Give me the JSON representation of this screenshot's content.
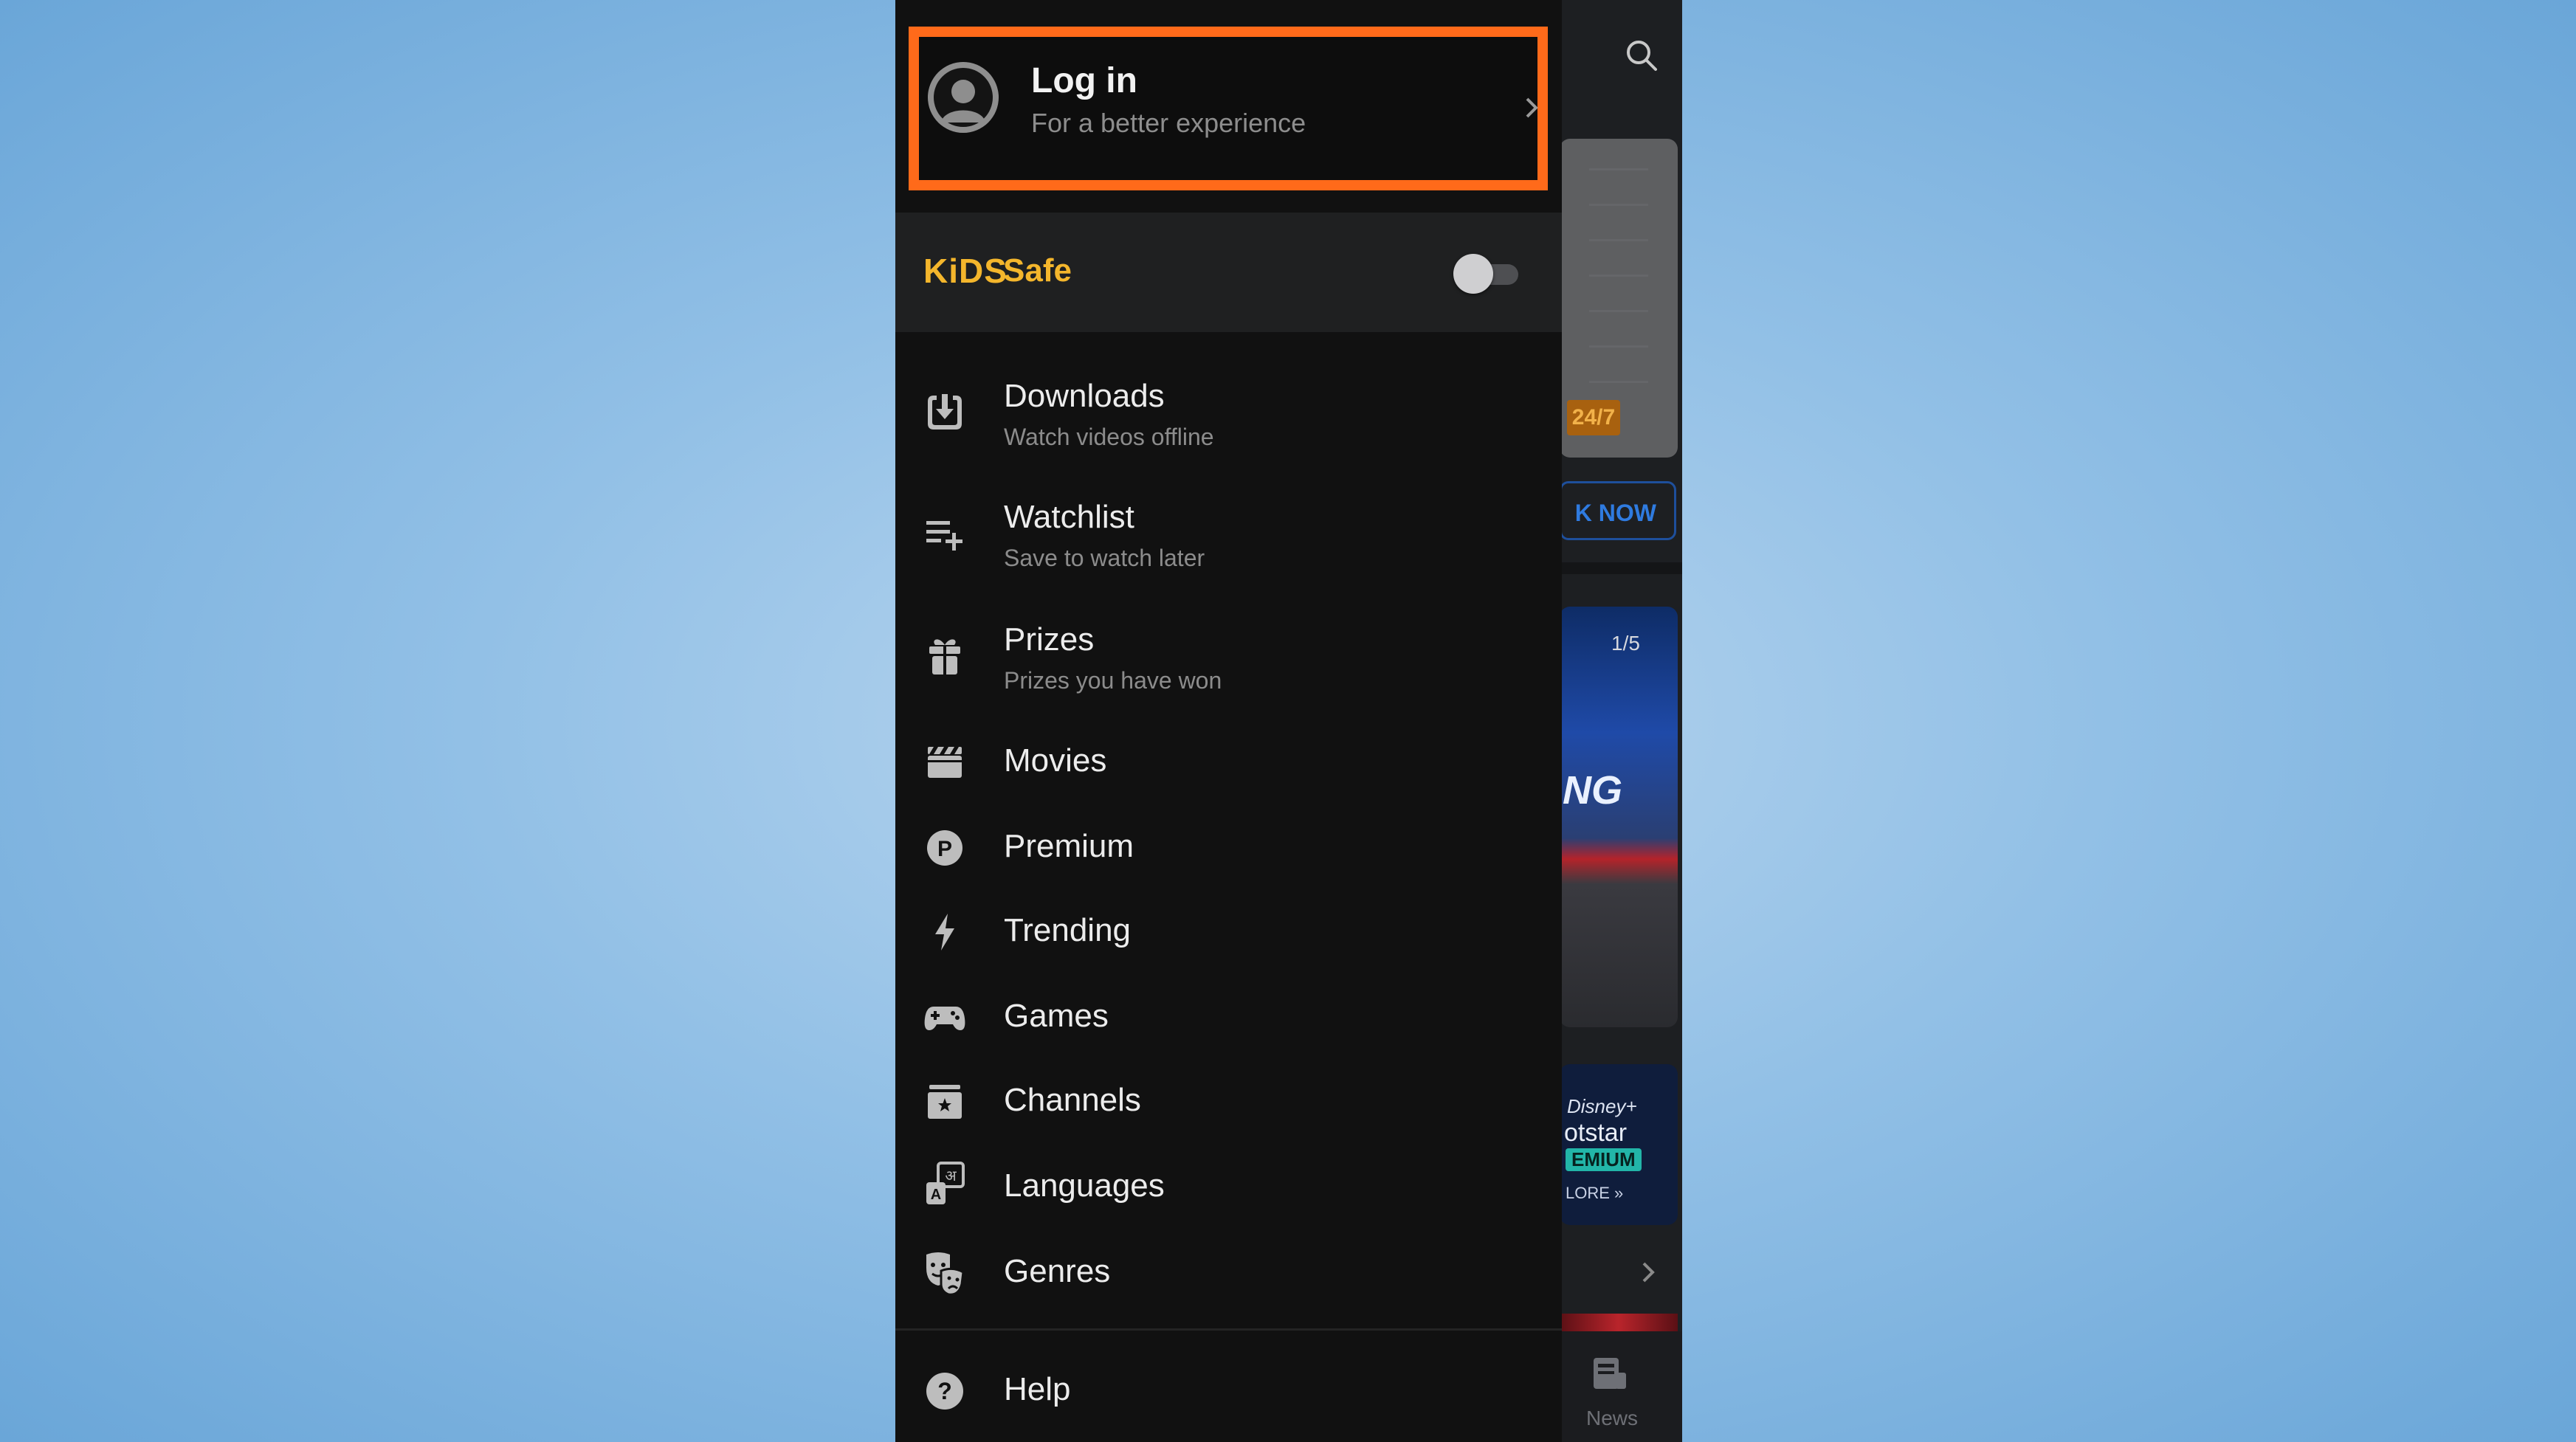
{
  "background_app": {
    "badge": "24/7",
    "book_button": "K NOW",
    "carousel_counter": "1/5",
    "carousel_overlay": "NG",
    "promo": {
      "brand_line1": "Disney+",
      "brand_line2": "otstar",
      "tag": "EMIUM",
      "cta": "LORE »"
    },
    "nav_news_label": "News",
    "icons": {
      "search": "search-icon",
      "news": "news-icon",
      "chevron": "chevron-right-icon"
    }
  },
  "drawer": {
    "login": {
      "title": "Log in",
      "subtitle": "For a better experience",
      "highlight_color": "#ff6a1a"
    },
    "kids": {
      "logo": "KiDS",
      "label": "Safe",
      "toggle_on": false,
      "accent_color": "#f4b62c"
    },
    "menu": [
      {
        "label": "Downloads",
        "subtitle": "Watch videos offline",
        "icon": "download-icon"
      },
      {
        "label": "Watchlist",
        "subtitle": "Save to watch later",
        "icon": "playlist-add-icon"
      },
      {
        "label": "Prizes",
        "subtitle": "Prizes you have won",
        "icon": "gift-icon"
      },
      {
        "label": "Movies",
        "icon": "clapperboard-icon"
      },
      {
        "label": "Premium",
        "icon": "premium-p-icon"
      },
      {
        "label": "Trending",
        "icon": "lightning-icon"
      },
      {
        "label": "Games",
        "icon": "gamepad-icon"
      },
      {
        "label": "Channels",
        "icon": "channels-icon"
      },
      {
        "label": "Languages",
        "icon": "languages-icon"
      },
      {
        "label": "Genres",
        "icon": "theater-masks-icon"
      }
    ],
    "footer_item": {
      "label": "Help",
      "icon": "help-icon"
    }
  }
}
